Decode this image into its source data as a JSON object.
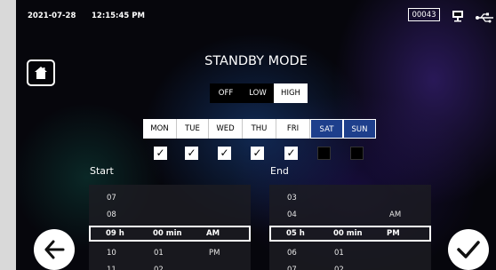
{
  "status_bar": {
    "date": "2021-07-28",
    "time": "12:15:45 PM",
    "counter": "00043",
    "icons": [
      "monitor-icon",
      "usb-icon"
    ]
  },
  "nav": {
    "home_icon": "home-icon",
    "back_icon": "back-arrow-icon",
    "confirm_icon": "checkmark-icon"
  },
  "title": "STANDBY MODE",
  "levels": [
    {
      "label": "OFF",
      "selected": false
    },
    {
      "label": "LOW",
      "selected": false
    },
    {
      "label": "HIGH",
      "selected": true
    }
  ],
  "days": [
    {
      "label": "MON",
      "selected": true
    },
    {
      "label": "TUE",
      "selected": true
    },
    {
      "label": "WED",
      "selected": true
    },
    {
      "label": "THU",
      "selected": true
    },
    {
      "label": "FRI",
      "selected": true
    },
    {
      "label": "SAT",
      "selected": false
    },
    {
      "label": "SUN",
      "selected": false
    }
  ],
  "start": {
    "heading": "Start",
    "rows": [
      {
        "hour": "07",
        "minute": "",
        "ampm": ""
      },
      {
        "hour": "08",
        "minute": "",
        "ampm": ""
      },
      {
        "hour": "09 h",
        "minute": "00 min",
        "ampm": "AM"
      },
      {
        "hour": "10",
        "minute": "01",
        "ampm": "PM"
      },
      {
        "hour": "11",
        "minute": "02",
        "ampm": ""
      }
    ]
  },
  "end": {
    "heading": "End",
    "rows": [
      {
        "hour": "03",
        "minute": "",
        "ampm": ""
      },
      {
        "hour": "04",
        "minute": "",
        "ampm": "AM"
      },
      {
        "hour": "05 h",
        "minute": "00 min",
        "ampm": "PM"
      },
      {
        "hour": "06",
        "minute": "01",
        "ampm": ""
      },
      {
        "hour": "07",
        "minute": "02",
        "ampm": ""
      }
    ]
  }
}
